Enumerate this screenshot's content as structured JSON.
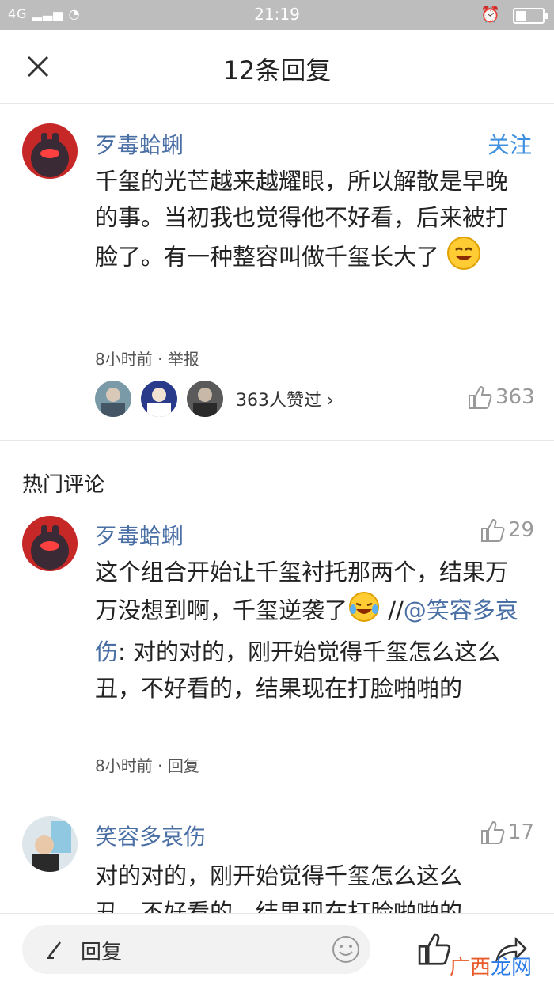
{
  "status_bar": {
    "signal": "4G",
    "time": "21:19"
  },
  "header": {
    "title": "12条回复"
  },
  "main_post": {
    "author": "歹毒蛤蜊",
    "follow_label": "关注",
    "text": "千玺的光芒越来越耀眼，所以解散是早晚的事。当初我也觉得他不好看，后来被打脸了。有一种整容叫做千玺长大了",
    "time": "8小时前",
    "report_label": "举报",
    "likers_text": "363人赞过",
    "like_count": "363"
  },
  "section_title": "热门评论",
  "comments": [
    {
      "author": "歹毒蛤蜊",
      "like_count": "29",
      "text_main": "这个组合开始让千玺衬托那两个，结果万万没想到啊，千玺逆袭了",
      "quote_prefix": "//",
      "quote_user": "@笑容多哀伤",
      "quote_text": ": 对的对的，刚开始觉得千玺怎么这么丑，不好看的，结果现在打脸啪啪的",
      "time": "8小时前",
      "reply_label": "回复"
    },
    {
      "author": "笑容多哀伤",
      "like_count": "17",
      "text": "对的对的，刚开始觉得千玺怎么这么丑，不好看的，结果现在打脸啪啪的"
    }
  ],
  "bottom_bar": {
    "reply_label": "回复"
  },
  "watermark": {
    "part1": "广西",
    "part2": "龙网"
  }
}
